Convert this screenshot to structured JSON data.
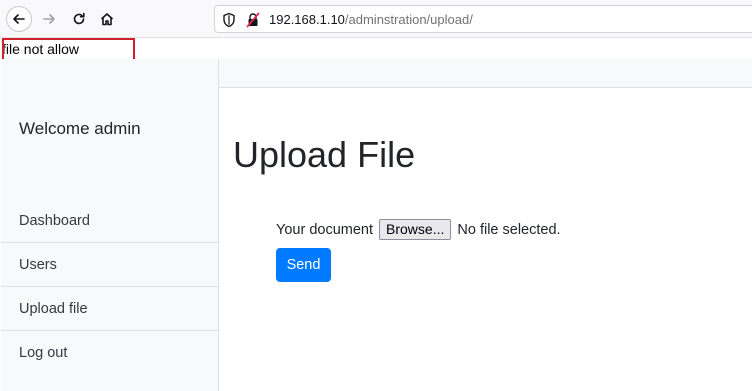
{
  "browser": {
    "url_host": "192.168.1.10",
    "url_path": "/adminstration/upload/",
    "icons": [
      "back-icon",
      "forward-icon",
      "reload-icon",
      "home-icon",
      "shield-icon",
      "insecure-lock-icon"
    ]
  },
  "message": {
    "text": "file not allow",
    "highlight_color": "#d0202a"
  },
  "sidebar": {
    "welcome": "Welcome admin",
    "items": [
      {
        "label": "Dashboard"
      },
      {
        "label": "Users"
      },
      {
        "label": "Upload file"
      },
      {
        "label": "Log out"
      }
    ]
  },
  "main": {
    "title": "Upload File",
    "form": {
      "file_label": "Your document",
      "browse_label": "Browse...",
      "file_status": "No file selected.",
      "send_label": "Send"
    }
  },
  "colors": {
    "primary": "#007bff",
    "sidebar_bg": "#f8f9fa"
  }
}
